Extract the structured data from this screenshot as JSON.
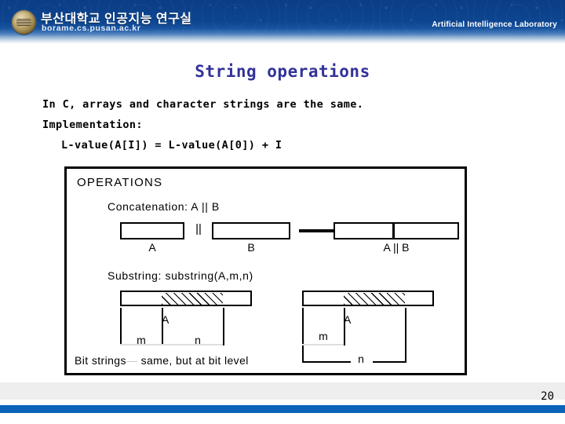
{
  "banner": {
    "lab_name_ko": "부산대학교 인공지능 연구실",
    "url": "borame.cs.pusan.ac.kr",
    "lab_name_en": "Artificial Intelligence Laboratory",
    "logo_icon": "university-emblem-icon",
    "background_color": "#0d4590"
  },
  "slide": {
    "title": "String operations",
    "title_color": "#333399",
    "lines": [
      "In C, arrays and character strings are the same.",
      "Implementation:",
      "L-value(A[I]) = L-value(A[0]) + I"
    ]
  },
  "figure": {
    "heading": "OPERATIONS",
    "concatenation": {
      "label": "Concatenation:  A || B",
      "operand_a": "A",
      "operator": "||",
      "operand_b": "B",
      "arrow_icon": "right-arrow-icon",
      "result": "A || B"
    },
    "substring": {
      "label": "Substring:  substring(A,m,n)",
      "left_diagram": {
        "segment_label": "A",
        "offset_label": "m",
        "length_label": "n"
      },
      "right_diagram": {
        "segment_label": "A",
        "offset_label": "m",
        "length_label": "n"
      }
    },
    "bit_strings": {
      "prefix": "Bit strings",
      "dash": "—",
      "suffix": "same, but at bit  level"
    }
  },
  "footer": {
    "page_number": "20",
    "bar_color": "#0a63b8"
  }
}
